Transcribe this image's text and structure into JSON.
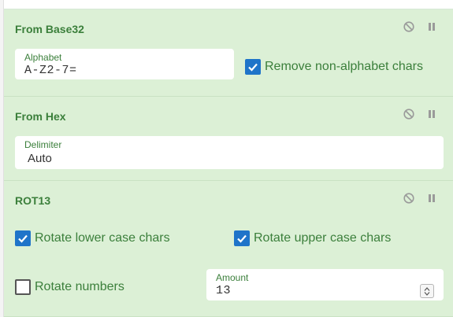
{
  "operations": [
    {
      "title": "From Base32",
      "alphabet": {
        "label": "Alphabet",
        "value": "A-Z2-7="
      },
      "remove_non_alphabet": {
        "label": "Remove non-alphabet chars",
        "checked": true
      }
    },
    {
      "title": "From Hex",
      "delimiter": {
        "label": "Delimiter",
        "value": "Auto"
      }
    },
    {
      "title": "ROT13",
      "rotate_lower": {
        "label": "Rotate lower case chars",
        "checked": true
      },
      "rotate_upper": {
        "label": "Rotate upper case chars",
        "checked": true
      },
      "rotate_numbers": {
        "label": "Rotate numbers",
        "checked": false
      },
      "amount": {
        "label": "Amount",
        "value": "13"
      }
    }
  ],
  "icons": {
    "disable": "disable-icon",
    "pause": "pause-icon",
    "checkmark": "checkmark-icon"
  },
  "colors": {
    "panel_bg": "#dcf0d6",
    "text_green": "#3b7f3b",
    "checkbox_blue": "#1f74c9",
    "control_gray": "#9a9a9a"
  }
}
